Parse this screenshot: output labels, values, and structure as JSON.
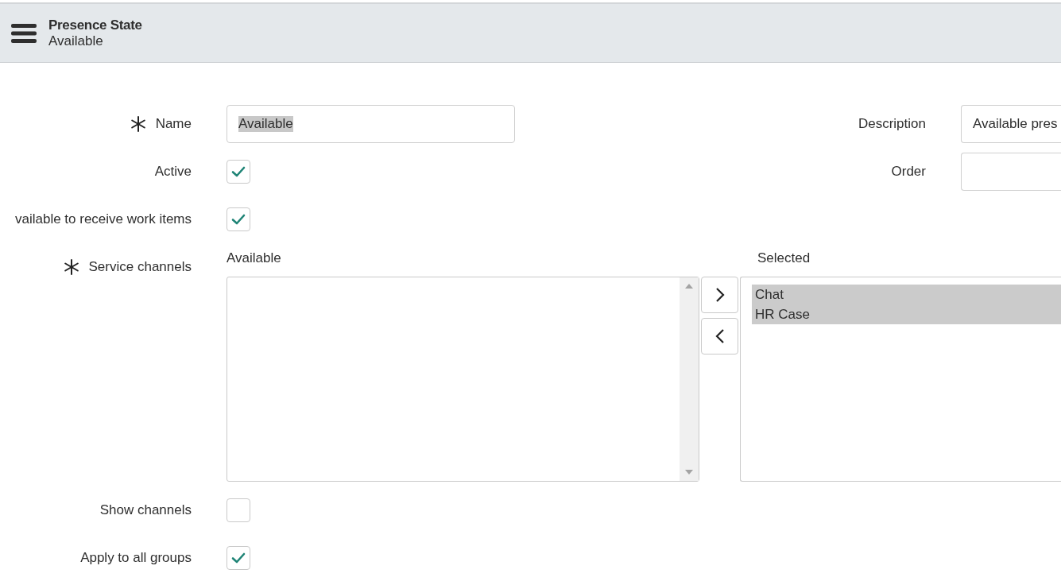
{
  "header": {
    "title": "Presence State",
    "subtitle": "Available"
  },
  "main_fields": [
    {
      "kind": "text",
      "label": "Name",
      "required": true,
      "value": "Available",
      "value_selected": true
    },
    {
      "kind": "checkbox",
      "label": "Active",
      "required": false,
      "checked": true
    },
    {
      "kind": "checkbox",
      "label": "vailable to receive work items",
      "required": false,
      "checked": true
    }
  ],
  "side_fields": [
    {
      "kind": "text",
      "label": "Description",
      "value": "Available pres"
    },
    {
      "kind": "text",
      "label": "Order"
    }
  ],
  "service_channels": {
    "label": "Service channels",
    "required": true,
    "available_heading": "Available",
    "selected_heading": "Selected",
    "selected_items": [
      {
        "label": "Chat",
        "selected": true
      },
      {
        "label": "HR Case",
        "selected": true
      }
    ]
  },
  "lower_fields": [
    {
      "kind": "checkbox",
      "label": "Show channels",
      "required": false,
      "checked": false
    },
    {
      "kind": "checkbox",
      "label": "Apply to all groups",
      "required": false,
      "checked": true
    }
  ]
}
